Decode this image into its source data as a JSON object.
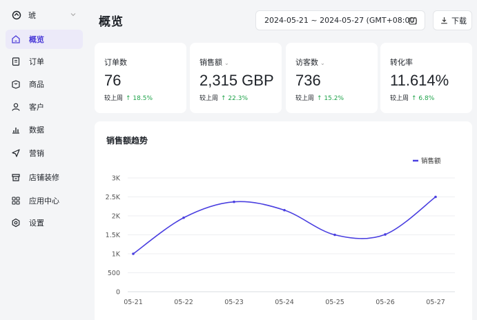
{
  "sidebar": {
    "store_name": "琥",
    "items": [
      {
        "key": "overview",
        "label": "概览",
        "icon": "home-icon",
        "active": true
      },
      {
        "key": "orders",
        "label": "订单",
        "icon": "document-icon",
        "active": false
      },
      {
        "key": "products",
        "label": "商品",
        "icon": "box-icon",
        "active": false
      },
      {
        "key": "customers",
        "label": "客户",
        "icon": "user-icon",
        "active": false
      },
      {
        "key": "data",
        "label": "数据",
        "icon": "bar-chart-icon",
        "active": false
      },
      {
        "key": "marketing",
        "label": "营销",
        "icon": "send-icon",
        "active": false
      },
      {
        "key": "decoration",
        "label": "店铺装修",
        "icon": "storefront-icon",
        "active": false
      },
      {
        "key": "apps",
        "label": "应用中心",
        "icon": "apps-grid-icon",
        "active": false
      },
      {
        "key": "settings",
        "label": "设置",
        "icon": "gear-icon",
        "active": false
      }
    ]
  },
  "header": {
    "title": "概览",
    "date_range": "2024-05-21 ~ 2024-05-27 (GMT+08:00)",
    "download_label": "下载"
  },
  "stats": [
    {
      "label": "订单数",
      "value": "76",
      "compare_label": "较上周",
      "change": "18.5%",
      "has_caret": false
    },
    {
      "label": "销售额",
      "value": "2,315 GBP",
      "compare_label": "较上周",
      "change": "22.3%",
      "has_caret": true
    },
    {
      "label": "访客数",
      "value": "736",
      "compare_label": "较上周",
      "change": "15.2%",
      "has_caret": true
    },
    {
      "label": "转化率",
      "value": "11.614%",
      "compare_label": "较上周",
      "change": "6.8%",
      "has_caret": false
    }
  ],
  "colors": {
    "accent": "#4c3cd8",
    "line": "#4a3fe0",
    "positive": "#1fa34a"
  },
  "chart_data": {
    "type": "line",
    "title": "销售额趋势",
    "categories": [
      "05-21",
      "05-22",
      "05-23",
      "05-24",
      "05-25",
      "05-26",
      "05-27"
    ],
    "series": [
      {
        "name": "销售额",
        "values": [
          1000,
          1950,
          2370,
          2150,
          1500,
          1510,
          2500
        ]
      }
    ],
    "y_ticks": [
      "0",
      "500",
      "1K",
      "1.5K",
      "2K",
      "2.5K",
      "3K"
    ],
    "ylim": [
      0,
      3000
    ],
    "grid": true,
    "legend_position": "top-right",
    "xlabel": "",
    "ylabel": ""
  }
}
